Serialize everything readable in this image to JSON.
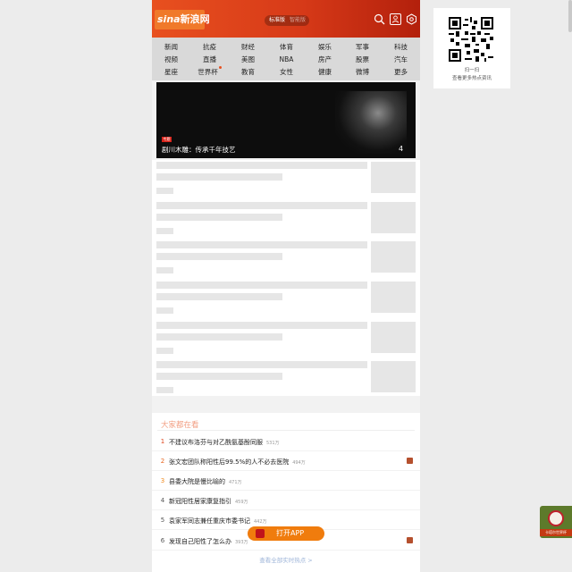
{
  "header": {
    "logo_text": "新浪网",
    "logo_brand": "sina",
    "mode_standard": "标准版",
    "mode_other": "智能版",
    "icons": [
      "search-icon",
      "user-icon",
      "settings-icon"
    ]
  },
  "nav": {
    "rows": [
      [
        "新闻",
        "抗疫",
        "财经",
        "体育",
        "娱乐",
        "军事",
        "科技"
      ],
      [
        "视频",
        "直播",
        "美图",
        "NBA",
        "房产",
        "股票",
        "汽车"
      ],
      [
        "星座",
        "世界杯",
        "教育",
        "女性",
        "健康",
        "微博",
        "更多"
      ]
    ]
  },
  "banner": {
    "badge": "专题",
    "title": "剧川木雕：传承千年技艺",
    "count": "4"
  },
  "trending": {
    "title": "大家都在看",
    "items": [
      {
        "rank": "1",
        "text": "不建议布洛芬与对乙酰氨基酚同服",
        "heat": "531万",
        "tag": false
      },
      {
        "rank": "2",
        "text": "张文宏团队称阳性后99.5%的人不必去医院",
        "heat": "494万",
        "tag": true
      },
      {
        "rank": "3",
        "text": "县委大院是慢比喻的",
        "heat": "471万",
        "tag": false
      },
      {
        "rank": "4",
        "text": "新冠阳性居家康复指引",
        "heat": "459万",
        "tag": false
      },
      {
        "rank": "5",
        "text": "袁家军同志兼任重庆市委书记",
        "heat": "442万",
        "tag": false
      },
      {
        "rank": "6",
        "text": "发现自己阳性了怎么办",
        "heat": "393万",
        "tag": true
      }
    ],
    "more": "查看全部实时热点 >"
  },
  "open_app": "打开APP",
  "qr": {
    "line1": "扫一扫",
    "line2": "查看更多热点资讯"
  },
  "worldcup_badge": "卡塔尔世界杯",
  "colors": {
    "header_start": "#e8501f",
    "header_end": "#b3200c",
    "accent": "#f07c0d",
    "rank_top": "#e0451b",
    "rank_mid": "#f08a1f"
  }
}
